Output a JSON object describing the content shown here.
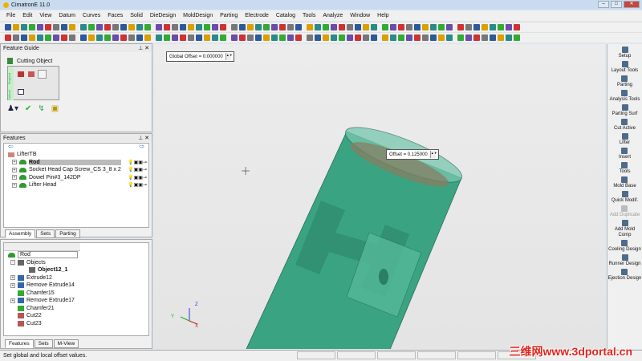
{
  "app": {
    "title": "CimatronE 11.0"
  },
  "menu": [
    "File",
    "Edit",
    "View",
    "Datum",
    "Curves",
    "Faces",
    "Solid",
    "DieDesign",
    "MoldDesign",
    "Parting",
    "Electrode",
    "Catalog",
    "Tools",
    "Analyze",
    "Window",
    "Help"
  ],
  "feature_guide": {
    "title": "Feature Guide",
    "step": "Cutting Object",
    "section_required": "Required",
    "section_optional": "Optional"
  },
  "features": {
    "title": "Features",
    "root": "LifterTB",
    "items": [
      "Rod",
      "Socket Head Cap Screw_CS 3_8 x 2",
      "Dowel Pin#3_142DP",
      "Lifter Head"
    ],
    "tabs": [
      "Assembly",
      "Sets",
      "Parting"
    ]
  },
  "tree": {
    "root": "Rod",
    "items": [
      {
        "label": "Objects",
        "level": 1,
        "exp": "-"
      },
      {
        "label": "Object12_1",
        "level": 2,
        "exp": ""
      },
      {
        "label": "Extrude12",
        "level": 1,
        "exp": "+"
      },
      {
        "label": "Remove Extrude14",
        "level": 1,
        "exp": "+"
      },
      {
        "label": "Chamfer15",
        "level": 1,
        "exp": ""
      },
      {
        "label": "Remove Extrude17",
        "level": 1,
        "exp": "+"
      },
      {
        "label": "Chamfer21",
        "level": 1,
        "exp": ""
      },
      {
        "label": "Cut22",
        "level": 1,
        "exp": ""
      },
      {
        "label": "Cut23",
        "level": 1,
        "exp": ""
      }
    ],
    "tabs": [
      "Features",
      "Sets",
      "M-View"
    ]
  },
  "viewport": {
    "global_offset": "Global Offset = 0.000000",
    "local_offset": "Offset = 0.125000",
    "axes": {
      "x": "X",
      "y": "Y",
      "z": "Z"
    }
  },
  "right_toolbar": [
    {
      "label": "Setup"
    },
    {
      "label": "Layout Tools"
    },
    {
      "label": "Parting"
    },
    {
      "label": "Analysis Tools"
    },
    {
      "label": "Parting Surf"
    },
    {
      "label": "Cut Active"
    },
    {
      "label": "Lifter"
    },
    {
      "label": "Insert"
    },
    {
      "label": "Tools"
    },
    {
      "label": "Mold Base"
    },
    {
      "label": "Quick Modif."
    },
    {
      "label": "Add Duplicate"
    },
    {
      "label": "Add Mold Comp"
    },
    {
      "label": "Cooling Design"
    },
    {
      "label": "Runner Design"
    },
    {
      "label": "Ejection Design"
    }
  ],
  "status": {
    "text": "Set global and local offset values."
  },
  "watermark": "三维网www.3dportal.cn",
  "colors": {
    "model": "#3aa482",
    "edge": "#2a6e58"
  }
}
